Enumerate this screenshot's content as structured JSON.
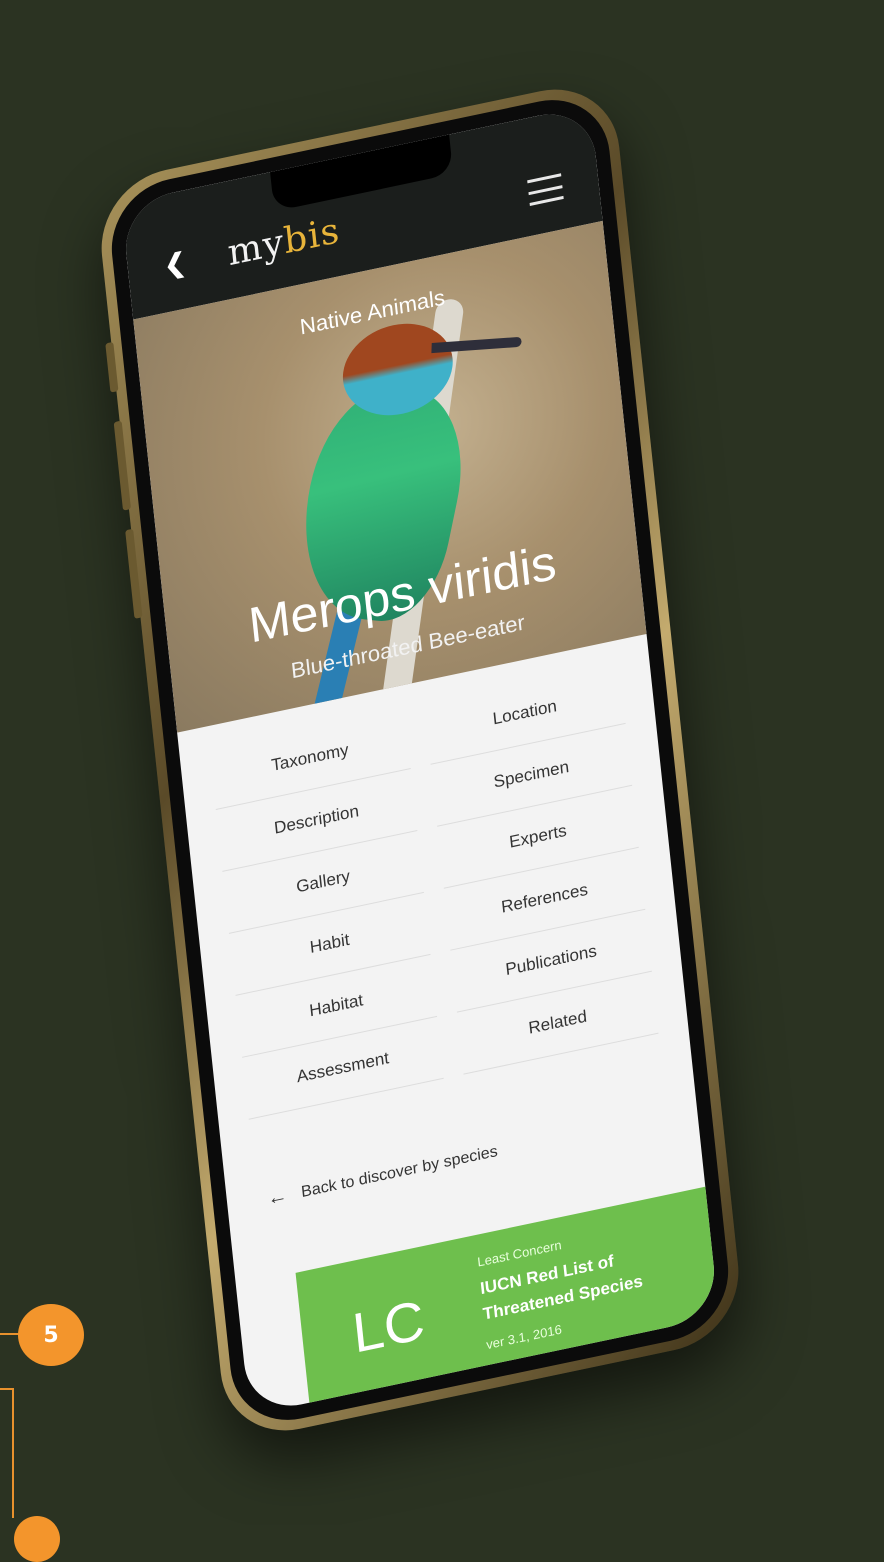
{
  "header": {
    "brand_prefix": "my",
    "brand_suffix": "bis",
    "back_icon": "chevron-left-icon",
    "menu_icon": "hamburger-menu-icon"
  },
  "hero": {
    "category": "Native Animals",
    "scientific_name": "Merops viridis",
    "common_name": "Blue-throated Bee-eater"
  },
  "sections": {
    "left": [
      "Taxonomy",
      "Description",
      "Gallery",
      "Habit",
      "Habitat",
      "Assessment"
    ],
    "right": [
      "Location",
      "Specimen",
      "Experts",
      "References",
      "Publications",
      "Related"
    ]
  },
  "back_link": {
    "label": "Back to discover by species",
    "icon": "arrow-left-icon"
  },
  "status": {
    "code": "LC",
    "label": "Least Concern",
    "title": "IUCN Red List of Threatened Species",
    "version": "ver 3.1, 2016",
    "color": "#6ebf4d"
  },
  "callout": {
    "step": "5",
    "color": "#f3952c"
  }
}
